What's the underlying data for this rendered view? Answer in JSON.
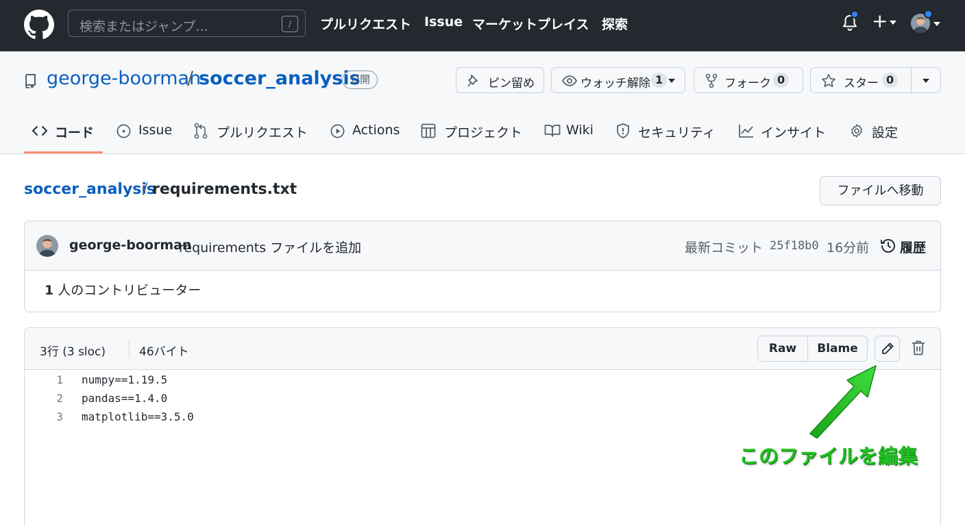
{
  "header": {
    "search_placeholder": "検索またはジャンプ...",
    "search_shortcut": "/",
    "nav": [
      "プルリクエスト",
      "Issue",
      "マーケットプレイス",
      "探索"
    ],
    "plus_label": "+"
  },
  "repo": {
    "owner": "george-boorman",
    "separator": "/",
    "name": "soccer_analysis",
    "visibility": "公開",
    "pin_label": "ピン留め",
    "watch_label": "ウォッチ解除",
    "watch_count": "1",
    "fork_label": "フォーク",
    "fork_count": "0",
    "star_label": "スター",
    "star_count": "0"
  },
  "tabs": [
    {
      "label": "コード",
      "icon": "code-icon",
      "selected": true
    },
    {
      "label": "Issue",
      "icon": "issue-icon"
    },
    {
      "label": "プルリクエスト",
      "icon": "pull-request-icon"
    },
    {
      "label": "Actions",
      "icon": "play-icon"
    },
    {
      "label": "プロジェクト",
      "icon": "table-icon"
    },
    {
      "label": "Wiki",
      "icon": "book-icon"
    },
    {
      "label": "セキュリティ",
      "icon": "shield-icon"
    },
    {
      "label": "インサイト",
      "icon": "graph-icon"
    },
    {
      "label": "設定",
      "icon": "gear-icon"
    }
  ],
  "breadcrumb": {
    "repo": "soccer_analysis",
    "separator": "/",
    "file": "requirements.txt",
    "goto_label": "ファイルへ移動"
  },
  "commit": {
    "author": "george-boorman",
    "message": "requirements ファイルを追加",
    "latest_label": "最新コミット",
    "sha": "25f18b0",
    "time": "16分前",
    "history_label": "履歴",
    "contributors_count": "1",
    "contributors_label": "人のコントリビューター"
  },
  "file": {
    "lines_info": "3行 (3 sloc)",
    "size": "46バイト",
    "raw_label": "Raw",
    "blame_label": "Blame",
    "code_lines": [
      {
        "num": "1",
        "text": "numpy==1.19.5"
      },
      {
        "num": "2",
        "text": "pandas==1.4.0"
      },
      {
        "num": "3",
        "text": "matplotlib==3.5.0"
      }
    ]
  },
  "annotation": {
    "text": "このファイルを編集",
    "color": "#22c022"
  },
  "colors": {
    "header_bg": "#24292f",
    "link": "#0a5fbd",
    "tab_underline": "#fd8c73",
    "notification_dot": "#2f81f7"
  }
}
